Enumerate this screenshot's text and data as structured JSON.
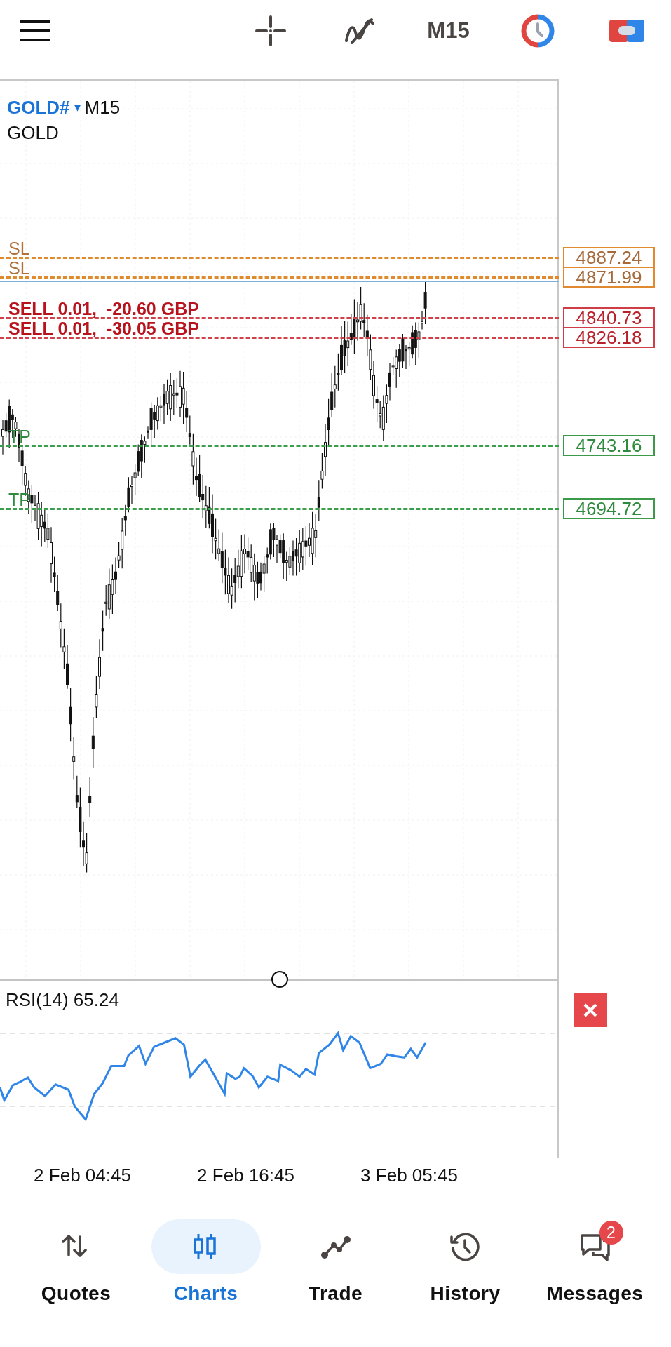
{
  "top_bar": {
    "timeframe_button": "M15"
  },
  "chart": {
    "symbol": "GOLD#",
    "symbol_caret": "▾",
    "timeframe": "M15",
    "description": "GOLD",
    "order_lines": [
      {
        "kind": "sl",
        "label": "SL",
        "price": "4887.24"
      },
      {
        "kind": "sl",
        "label": "SL",
        "price": "4871.99"
      },
      {
        "kind": "sell",
        "label": "SELL 0.01,  -20.60 GBP",
        "price": "4840.73"
      },
      {
        "kind": "sell",
        "label": "SELL 0.01,  -30.05 GBP",
        "price": "4826.18"
      },
      {
        "kind": "tp",
        "label": "TP",
        "price": "4743.16"
      },
      {
        "kind": "tp",
        "label": "TP",
        "price": "4694.72"
      }
    ]
  },
  "indicator": {
    "label": "RSI(14) 65.24"
  },
  "time_axis": [
    "2 Feb 04:45",
    "2 Feb 16:45",
    "3 Feb 05:45"
  ],
  "nav": [
    {
      "kind": "quotes",
      "label": "Quotes",
      "selected": false
    },
    {
      "kind": "charts",
      "label": "Charts",
      "selected": true
    },
    {
      "kind": "trade",
      "label": "Trade",
      "selected": false
    },
    {
      "kind": "history",
      "label": "History",
      "selected": false
    },
    {
      "kind": "messages",
      "label": "Messages",
      "selected": false,
      "badge": "2"
    }
  ]
}
